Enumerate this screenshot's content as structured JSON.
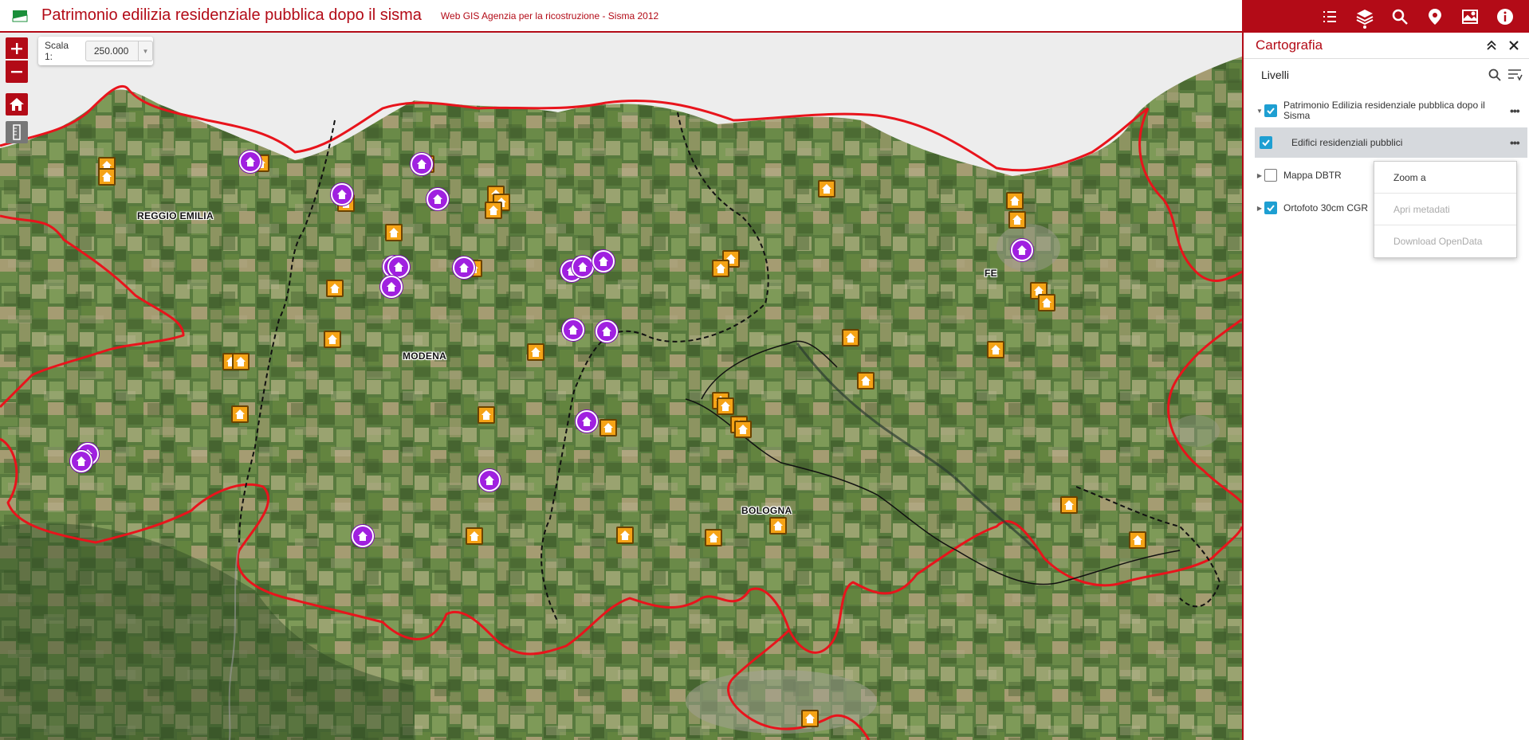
{
  "header": {
    "title": "Patrimonio edilizia residenziale pubblica dopo il sisma",
    "subtitle": "Web GIS Agenzia per la ricostruzione - Sisma 2012"
  },
  "toolbar": {
    "buttons": [
      "layer-list-icon",
      "layers-icon",
      "search-icon",
      "location-pin-icon",
      "basemap-icon",
      "info-icon"
    ],
    "active": "layers-icon"
  },
  "scale": {
    "label": "Scala 1:",
    "value": "250.000"
  },
  "panel": {
    "title": "Cartografia",
    "section_title": "Livelli",
    "layers": [
      {
        "label": "Patrimonio Edilizia residenziale pubblica dopo il Sisma",
        "checked": true,
        "expanded": true
      },
      {
        "label": "Edifici residenziali pubblici",
        "checked": true,
        "selected": true
      },
      {
        "label": "Mappa DBTR",
        "checked": false,
        "expanded": false
      },
      {
        "label": "Ortofoto 30cm CGR",
        "checked": true,
        "expanded": false
      }
    ],
    "context_menu": [
      {
        "label": "Zoom a",
        "enabled": true
      },
      {
        "label": "Apri metadati",
        "enabled": false
      },
      {
        "label": "Download OpenData",
        "enabled": false
      }
    ]
  },
  "map": {
    "cities": [
      "REGGIO EMILIA",
      "MODENA",
      "BOLOGNA",
      "FE"
    ],
    "colors": {
      "province_boundary": "#e8141c",
      "municipal_boundary": "#000000",
      "marker_orange": "#f5a316",
      "marker_purple": "#a020e0",
      "accent": "#b30b17"
    }
  }
}
